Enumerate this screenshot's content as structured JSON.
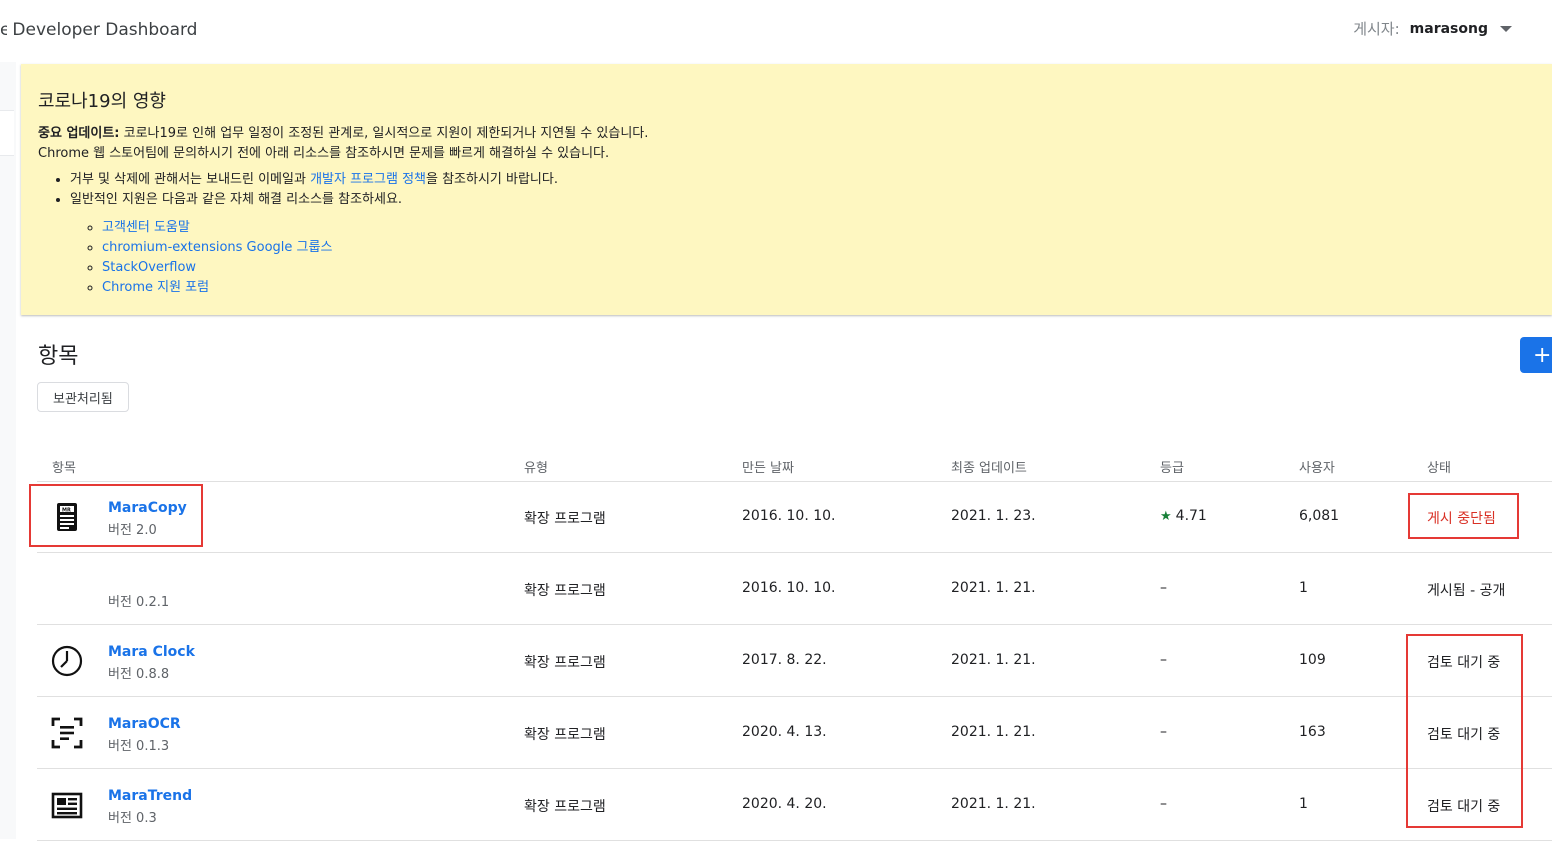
{
  "header": {
    "app_title_prefix": "e",
    "app_title": "Developer Dashboard",
    "publisher_label": "게시자:",
    "publisher_name": "marasong"
  },
  "notice": {
    "title": "코로나19의 영향",
    "important_label": "중요 업데이트:",
    "important_text": " 코로나19로 인해 업무 일정이 조정된 관계로, 일시적으로 지원이 제한되거나 지연될 수 있습니다.",
    "line2": "Chrome 웹 스토어팀에 문의하시기 전에 아래 리소스를 참조하시면 문제를 빠르게 해결하실 수 있습니다.",
    "bullet1_pre": "거부 및 삭제에 관해서는 보내드린 이메일과 ",
    "bullet1_link": "개발자 프로그램 정책",
    "bullet1_post": "을 참조하시기 바랍니다.",
    "bullet2": "일반적인 지원은 다음과 같은 자체 해결 리소스를 참조하세요.",
    "links": [
      "고객센터 도움말",
      "chromium-extensions Google 그룹스",
      "StackOverflow",
      "Chrome 지원 포럼"
    ]
  },
  "items_section": {
    "title": "항목",
    "archived_button": "보관처리됨",
    "add_button": "+",
    "columns": {
      "item": "항목",
      "type": "유형",
      "created": "만든 날짜",
      "updated": "최종 업데이트",
      "rating": "등급",
      "users": "사용자",
      "status": "상태"
    },
    "rows": [
      {
        "name": "MaraCopy",
        "version": "버전 2.0",
        "icon": "maracopy-document-icon",
        "type": "확장 프로그램",
        "created": "2016. 10. 10.",
        "updated": "2021. 1. 23.",
        "rating": "4.71",
        "users": "6,081",
        "status": "게시 중단됨",
        "status_color": "#d93025"
      },
      {
        "name": "",
        "version": "버전 0.2.1",
        "icon": "",
        "type": "확장 프로그램",
        "created": "2016. 10. 10.",
        "updated": "2021. 1. 21.",
        "rating": "–",
        "users": "1",
        "status": "게시됨 - 공개",
        "status_color": "#202124"
      },
      {
        "name": "Mara Clock",
        "version": "버전 0.8.8",
        "icon": "clock-icon",
        "type": "확장 프로그램",
        "created": "2017. 8. 22.",
        "updated": "2021. 1. 21.",
        "rating": "–",
        "users": "109",
        "status": "검토 대기 중",
        "status_color": "#202124"
      },
      {
        "name": "MaraOCR",
        "version": "버전 0.1.3",
        "icon": "ocr-scan-icon",
        "type": "확장 프로그램",
        "created": "2020. 4. 13.",
        "updated": "2021. 1. 21.",
        "rating": "–",
        "users": "163",
        "status": "검토 대기 중",
        "status_color": "#202124"
      },
      {
        "name": "MaraTrend",
        "version": "버전 0.3",
        "icon": "newspaper-icon",
        "type": "확장 프로그램",
        "created": "2020. 4. 20.",
        "updated": "2021. 1. 21.",
        "rating": "–",
        "users": "1",
        "status": "검토 대기 중",
        "status_color": "#202124"
      }
    ]
  }
}
